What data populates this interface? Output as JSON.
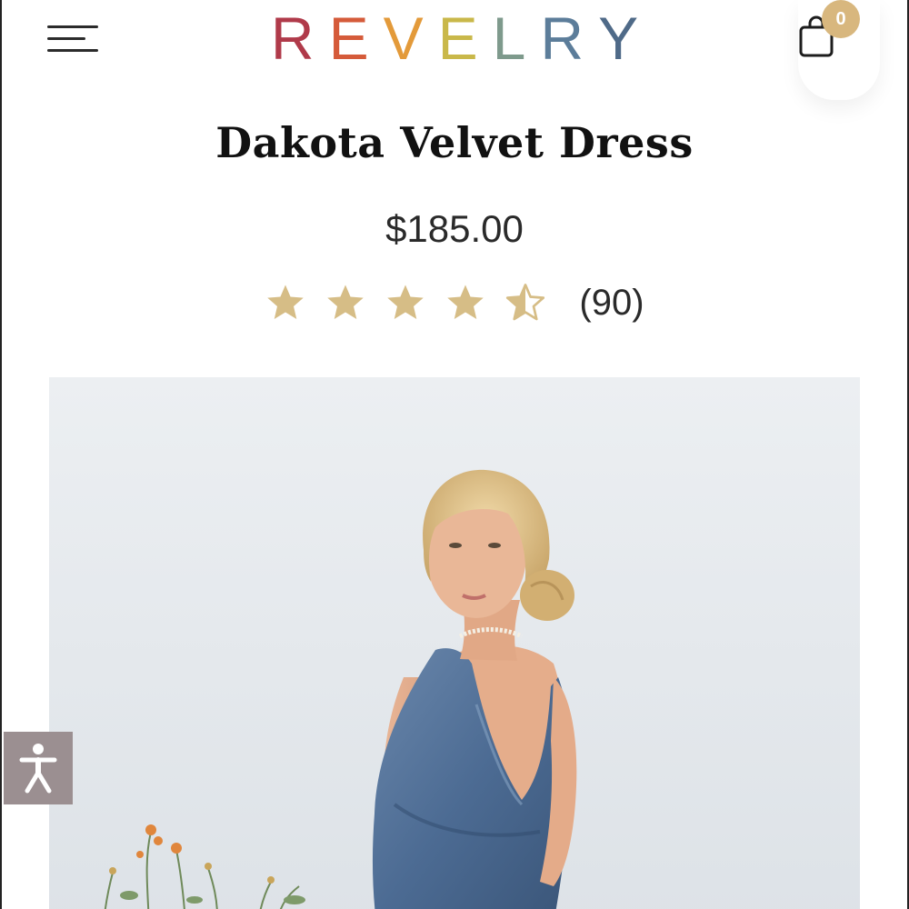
{
  "header": {
    "logo_letters": [
      {
        "char": "R",
        "color": "#b03a4a"
      },
      {
        "char": "E",
        "color": "#d55b3a"
      },
      {
        "char": "V",
        "color": "#e39a3a"
      },
      {
        "char": "E",
        "color": "#c9b84a"
      },
      {
        "char": "L",
        "color": "#7e9a8c"
      },
      {
        "char": "R",
        "color": "#5c7d9a"
      },
      {
        "char": "Y",
        "color": "#4f6a88"
      }
    ],
    "menu_icon": "hamburger-menu-icon",
    "cart_icon": "shopping-bag-icon",
    "cart_count": "0"
  },
  "product": {
    "title": "Dakota Velvet Dress",
    "price": "$185.00",
    "rating": 4.5,
    "review_count": "(90)",
    "star_color": "#d6bd86",
    "image_description_icon": "product-photo"
  },
  "accessibility": {
    "icon": "accessibility-person-icon"
  },
  "colors": {
    "accent_gold": "#d8b77e",
    "dress_blue": "#4c6b93"
  }
}
